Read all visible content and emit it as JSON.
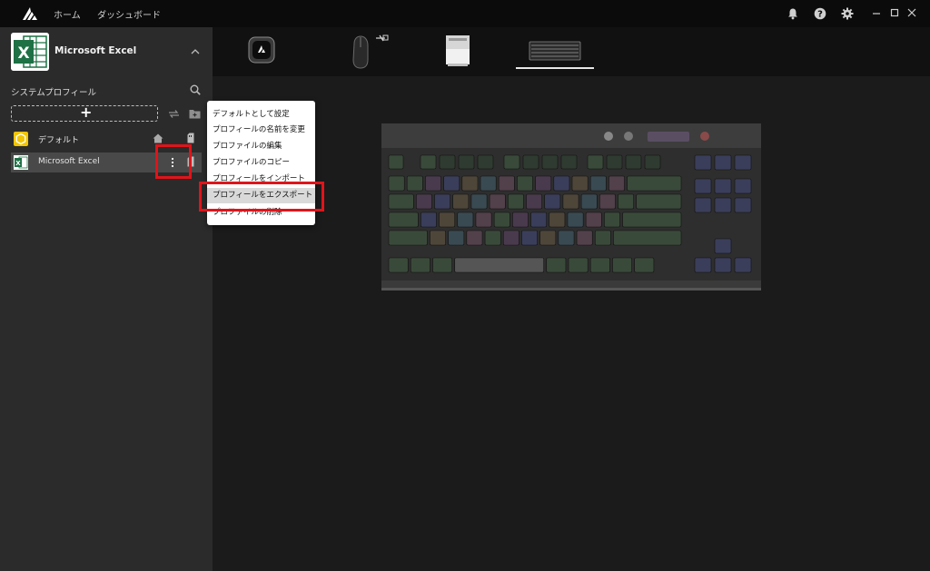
{
  "nav": {
    "home": "ホーム",
    "dashboard": "ダッシュボード"
  },
  "sidebar": {
    "app_title": "Microsoft Excel",
    "section_label": "システムプロフィール",
    "add_label": "+",
    "profiles": [
      {
        "label": "デフォルト"
      },
      {
        "label": "Microsoft Excel"
      }
    ]
  },
  "context_menu": {
    "items": [
      "デフォルトとして設定",
      "プロフィールの名前を変更",
      "プロファイルの編集",
      "プロファイルのコピー",
      "プロフィールをインポート",
      "プロフィールをエクスポート",
      "プロファイルの削除"
    ],
    "highlighted_index": 5
  },
  "colors": {
    "accent_highlight": "#e0141a",
    "excel_green": "#1e7145",
    "default_yellow": "#f2c500"
  }
}
